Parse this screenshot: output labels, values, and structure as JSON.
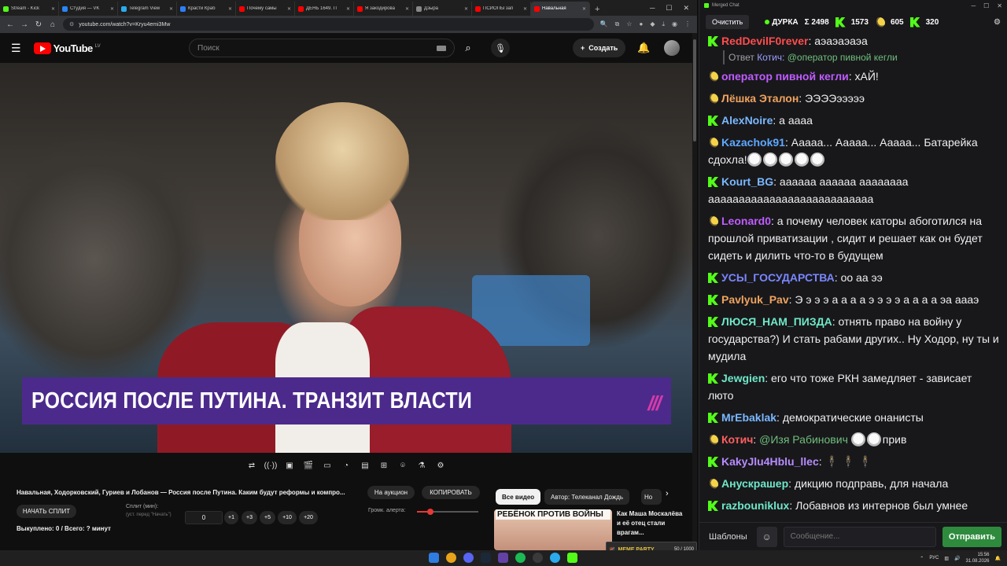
{
  "browser": {
    "tabs": [
      {
        "title": "Stream - Kick",
        "color": "#53fc18"
      },
      {
        "title": "Студия — VK",
        "color": "#2787f5"
      },
      {
        "title": "Telegram View",
        "color": "#2aabee"
      },
      {
        "title": "Красти Краб",
        "color": "#2d7ff9"
      },
      {
        "title": "Почему самы",
        "color": "#ff0000"
      },
      {
        "title": "ДЕНЬ 1649. П",
        "color": "#ff0000"
      },
      {
        "title": "Я закодирова",
        "color": "#ff0000"
      },
      {
        "title": "Дзыра",
        "color": "#888888"
      },
      {
        "title": "ПСИОПЫ зап",
        "color": "#ff0000"
      },
      {
        "title": "Навальная",
        "color": "#ff0000"
      }
    ],
    "url": "youtube.com/watch?v=Kryu4emi3Mw"
  },
  "youtube": {
    "logo_text": "YouTube",
    "region": "LV",
    "search_placeholder": "Поиск",
    "create_label": "Создать",
    "video_banner": "РОССИЯ ПОСЛЕ ПУТИНА. ТРАНЗИТ ВЛАСТИ",
    "video_logo": "///",
    "video_title": "Навальная, Ходорковский, Гуриев и Лобанов — Россия после Путина. Каким будут реформы и компро...",
    "start_split": "НАЧАТЬ СПЛИТ",
    "split_label": "Сплит (мин):",
    "split_sub": "(уст. перед \"Начать\")",
    "split_value": "0",
    "steps": [
      "+1",
      "+3",
      "+5",
      "+10",
      "+20"
    ],
    "bought": "Выкуплено: 0 / Всего: ? минут",
    "auction": "На аукцион",
    "copy": "КОПИРОВАТЬ",
    "volume_label": "Громк. алерта:",
    "volume_level": 0.22,
    "chips": [
      "Все видео",
      "Автор: Телеканал Дождь",
      "Но"
    ],
    "rec_thumb_title": "РЕБЁНОК ПРОТИВ ВОЙНЫ",
    "rec_title": "Как Маша Москалёва и её отец стали врагам..."
  },
  "chat": {
    "window_title": "Merged Chat",
    "clear": "Очистить",
    "channel": "ДУРКА",
    "total": "Σ 2498",
    "kick_count": "1573",
    "twitch_count": "605",
    "other_count": "320",
    "reply": {
      "label": "Ответ",
      "to": "Котич:",
      "mention": "@оператор пивной кегли"
    },
    "messages": [
      {
        "src": "kick",
        "nick": "RedDevilF0rever",
        "color": "#ff4d4d",
        "text": "аэаэаэаэа"
      },
      {
        "src": "twitch",
        "nick": "оператор пивной кегли",
        "color": "#c05cff",
        "text": "хАЙ!"
      },
      {
        "src": "twitch",
        "nick": "Лёшка Эталон",
        "color": "#f0a35e",
        "text": "ЭЭЭЭэээээ"
      },
      {
        "src": "kick",
        "nick": "AlexNoire",
        "color": "#7ab8ff",
        "text": "а аааа"
      },
      {
        "src": "twitch",
        "nick": "Kazachok91",
        "color": "#5fa8ff",
        "text": "Ааааа... Ааааа... Ааааа... Батарейка сдохла!"
      },
      {
        "src": "kick",
        "nick": "Kourt_BG",
        "color": "#7ab8ff",
        "text": "аааааа аааааа аааааааа ааааааааааааааааааааааааааа"
      },
      {
        "src": "twitch",
        "nick": "Leonard0",
        "color": "#c05cff",
        "text": "а почему человек каторы абоготился на прошлой  приватизации , сидит и решает как он будет сидеть и дилить что-то в будущем"
      },
      {
        "src": "kick",
        "nick": "УСЫ_ГОСУДАРСТВА",
        "color": "#7a86ff",
        "text": "оо аа ээ"
      },
      {
        "src": "kick",
        "nick": "Pavlyuk_Pav",
        "color": "#f0a35e",
        "text": "Э э э э а а а а э э э э а а а а эа аааэ"
      },
      {
        "src": "kick",
        "nick": "ЛЮСЯ_НАМ_ПИЗДА",
        "color": "#6fe8c8",
        "text": "отнять право на войну у государства?) И стать рабами других.. Ну Ходор, ну ты и мудила"
      },
      {
        "src": "kick",
        "nick": "Jewgien",
        "color": "#6fe8c8",
        "text": "его что тоже РКН замедляет - зависает люто"
      },
      {
        "src": "kick",
        "nick": "MrEbaklak",
        "color": "#7ab8ff",
        "text": "демократические онанисты"
      },
      {
        "src": "twitch",
        "nick": "Котич",
        "color": "#ff5f5f",
        "text": "прив",
        "mention": "@Изя Рабинович"
      },
      {
        "src": "kick",
        "nick": "KakyJlu4Hblu_llec",
        "color": "#b88cff",
        "text": "🕴 🕴 🕴"
      },
      {
        "src": "twitch",
        "nick": "Анускрашер",
        "color": "#6fe8c8",
        "text": "дикцию подправь, для начала"
      },
      {
        "src": "kick",
        "nick": "razbouniklux",
        "color": "#6fe8c8",
        "text": "Лобавнов из интернов был умнее"
      }
    ],
    "templates": "Шаблоны",
    "input_placeholder": "Сообщение...",
    "send": "Отправить"
  },
  "taskbar": {
    "lang": "РУС",
    "time": "15:56",
    "date": "31.08.2026",
    "widget_label": "MEME PARTY",
    "widget_progress": "50 / 1000"
  }
}
